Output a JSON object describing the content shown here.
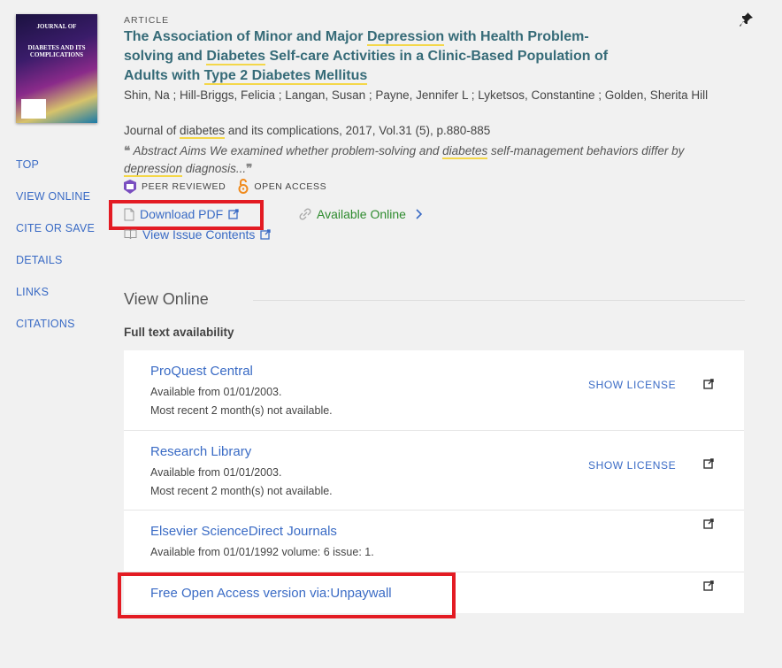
{
  "cover": {
    "line1": "JOURNAL OF",
    "line2": "DIABETES AND ITS COMPLICATIONS"
  },
  "nav": [
    "TOP",
    "VIEW ONLINE",
    "CITE OR SAVE",
    "DETAILS",
    "LINKS",
    "CITATIONS"
  ],
  "record": {
    "type": "ARTICLE",
    "title_parts": [
      "The Association of Minor and Major ",
      "Depression",
      " with Health Problem-solving and ",
      "Diabetes",
      " Self-care Activities in a Clinic-Based Population of Adults with ",
      "Type 2 Diabetes Mellitus"
    ],
    "authors": "Shin, Na ; Hill-Briggs, Felicia ; Langan, Susan ; Payne, Jennifer L ; Lyketsos, Constantine ; Golden, Sherita Hill",
    "journal_parts": [
      "Journal of ",
      "diabetes",
      " and its complications, 2017, Vol.31 (5), p.880-885"
    ],
    "abstract_parts": [
      "Abstract Aims We examined whether problem-solving and ",
      "diabetes",
      " self-management behaviors differ by ",
      "depression",
      " diagnosis..."
    ],
    "badges": {
      "peer": "PEER REVIEWED",
      "open": "OPEN ACCESS"
    },
    "download_pdf": "Download PDF",
    "available_online": "Available Online",
    "view_issue": "View Issue Contents"
  },
  "view_online": {
    "heading": "View Online",
    "subheading": "Full text availability",
    "license_label": "SHOW LICENSE",
    "sources": [
      {
        "name": "ProQuest Central",
        "line1": "Available from 01/01/2003.",
        "line2": "Most recent 2 month(s) not available."
      },
      {
        "name": "Research Library",
        "line1": "Available from 01/01/2003.",
        "line2": "Most recent 2 month(s) not available."
      },
      {
        "name": "Elsevier ScienceDirect Journals",
        "line1": "Available from 01/01/1992 volume: 6 issue: 1."
      },
      {
        "name": "Free Open Access version via:Unpaywall"
      }
    ]
  },
  "colors": {
    "link": "#3a6bc5",
    "title": "#366b78",
    "highlight": "#f4d749",
    "annotation": "#e31b23",
    "available": "#2e8b2e"
  }
}
